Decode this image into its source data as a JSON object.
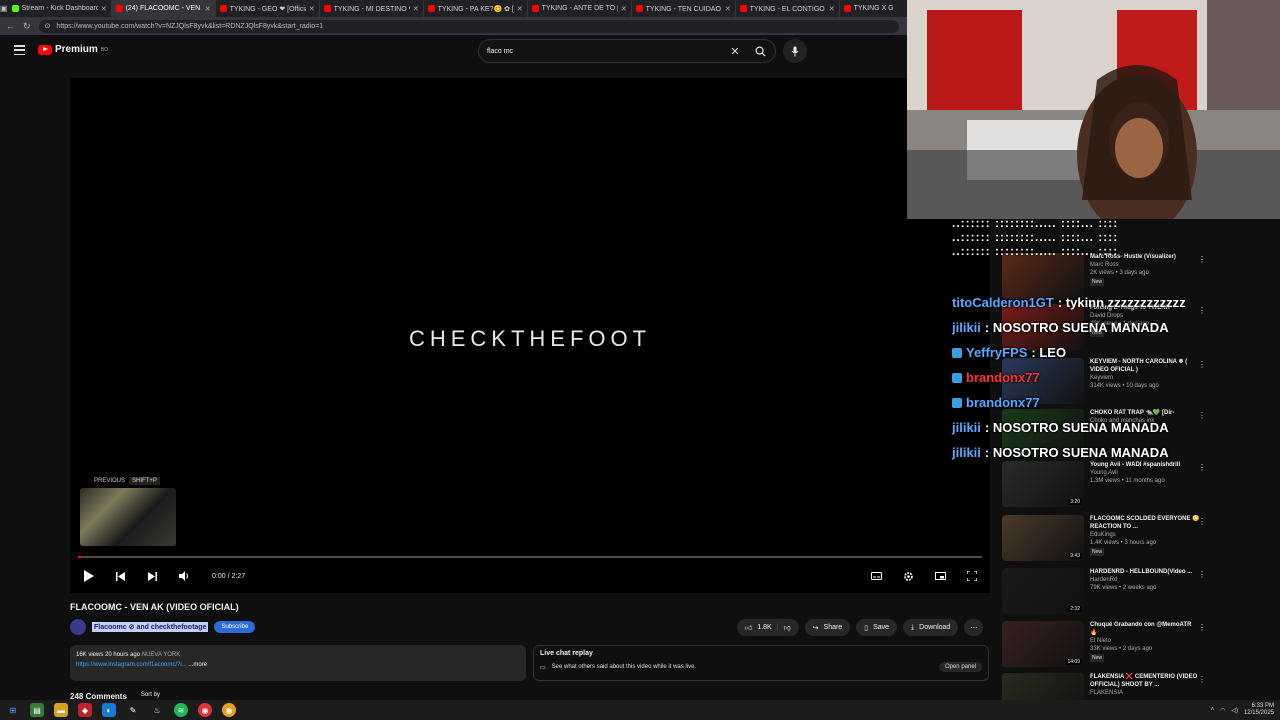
{
  "browser": {
    "tabs": [
      {
        "title": "Stream - Kick Dashboard",
        "color": "#53fc18",
        "active": false
      },
      {
        "title": "(24) FLACOOMC - VEN AK",
        "color": "#ff0000",
        "active": true
      },
      {
        "title": "TYKING - GEO ❤ [Official Vi",
        "color": "#ff0000",
        "active": false
      },
      {
        "title": "TYKING - MI DESTINO ❤ [O",
        "color": "#ff0000",
        "active": false
      },
      {
        "title": "TYKING - PA KE?😊 ✿ [ Off",
        "color": "#ff0000",
        "active": false
      },
      {
        "title": "TYKING - ANTE DE TO [Offi",
        "color": "#ff0000",
        "active": false
      },
      {
        "title": "TYKING - TEN CUIDAO PT2 🔥",
        "color": "#ff0000",
        "active": false
      },
      {
        "title": "TYKING - EL CONTIGO ❤🔥",
        "color": "#ff0000",
        "active": false
      },
      {
        "title": "TYKING X G",
        "color": "#ff0000",
        "active": false
      }
    ],
    "url": "https://www.youtube.com/watch?v=NZJQlsF8yvk&list=RDNZJQlsF8yvk&start_radio=1"
  },
  "header": {
    "logo_text": "Premium",
    "logo_sup": "BO",
    "search_value": "flaco mc"
  },
  "player": {
    "video_text": "CHECKTHEFOOT",
    "prev_label": "PREVIOUS",
    "prev_shortcut": "SHIFT+P",
    "time": "0:00 / 2:27",
    "progress": 0.004
  },
  "video": {
    "title": "FLACOOMC - VEN AK (VIDEO OFICIAL)",
    "channel": "Flacoomc",
    "collab": "and checkthefootage",
    "subscribe": "Subscribe",
    "likes": "1.8K",
    "share": "Share",
    "save": "Save",
    "download": "Download",
    "views": "16K views",
    "age": "20 hours ago",
    "place": "NUEVA YORK",
    "desc_link": "https://www.instagram.com/f1acoomc/?i...",
    "more": "...more",
    "comments": "248 Comments",
    "sort": "Sort by"
  },
  "livechat": {
    "title": "Live chat replay",
    "text": "See what others said about this video while it was live.",
    "open": "Open panel"
  },
  "recommendations": [
    {
      "title": "Marc Ross- Hustle (Visualizer)",
      "channel": "Marc Ross",
      "meta": "2K views • 3 days ago",
      "badge": "New",
      "duration": "",
      "color": "#5a2a18"
    },
    {
      "title": "Forcing E-Thugs To TWERK",
      "channel": "David Drops",
      "meta": "49K views • 1 day ago",
      "badge": "New",
      "duration": "",
      "color": "#7a1a1a"
    },
    {
      "title": "KEYVIEM - NORTH CAROLINA ❄ ( VIDEO OFICIAL )",
      "channel": "Keyviem",
      "meta": "314K views • 10 days ago",
      "badge": "",
      "duration": "",
      "color": "#2a3a5a"
    },
    {
      "title": "CHOKO RAT TRAP 🐀💚 [Dir-",
      "channel": "Choko and manchas ink",
      "meta": "",
      "badge": "",
      "duration": "",
      "color": "#1a3a1a"
    },
    {
      "title": "Young Avii - WADI #spanishdrill",
      "channel": "Young Avii",
      "meta": "1.3M views • 11 months ago",
      "badge": "",
      "duration": "3:20",
      "color": "#2a2a2a"
    },
    {
      "title": "FLACOOMC SCOLDED EVERYONE 😳 REACTION TO ...",
      "channel": "EduKings",
      "meta": "1.4K views • 3 hours ago",
      "badge": "New",
      "duration": "9:43",
      "color": "#4a3a2a"
    },
    {
      "title": "HARDENRD - HELLBOUND(Video ...",
      "channel": "HardenRd",
      "meta": "79K views • 2 weeks ago",
      "badge": "",
      "duration": "2:32",
      "color": "#1a1a1a"
    },
    {
      "title": "Chuqué Grabando con @MemoATR 🔥",
      "channel": "El Nieto",
      "meta": "33K views • 2 days ago",
      "badge": "New",
      "duration": "14:09",
      "color": "#3a2020"
    },
    {
      "title": "FLAKENSIA ❌ CEMENTERIO (VIDEO OFFICIAL) SHOOT BY ...",
      "channel": "FLAKENSIA",
      "meta": "",
      "badge": "",
      "duration": "",
      "color": "#2a2a20"
    }
  ],
  "chat": [
    {
      "user": "titoCalderon1GT",
      "msg": ": tykinn zzzzzzzzzzzz",
      "color": "blue",
      "badge": false
    },
    {
      "user": "jilikii",
      "msg": ": NOSOTRO SUENA MANADA",
      "color": "blue",
      "badge": false
    },
    {
      "user": "YeffryFPS",
      "msg": ": LEO",
      "color": "blue",
      "badge": true
    },
    {
      "user": "brandonx77",
      "msg": "",
      "color": "red",
      "badge": true
    },
    {
      "user": "brandonx77",
      "msg": "",
      "color": "blue",
      "badge": true
    },
    {
      "user": "jilikii",
      "msg": ": NOSOTRO SUENA MANADA",
      "color": "blue",
      "badge": false
    },
    {
      "user": "jilikii",
      "msg": ": NOSOTRO SUENA MANADA",
      "color": "blue",
      "badge": false
    }
  ],
  "overlay_bars": "..:::::: ::::::::..... ::::... ::::",
  "tray": {
    "time": "6:33 PM",
    "date": "12/15/2025"
  }
}
